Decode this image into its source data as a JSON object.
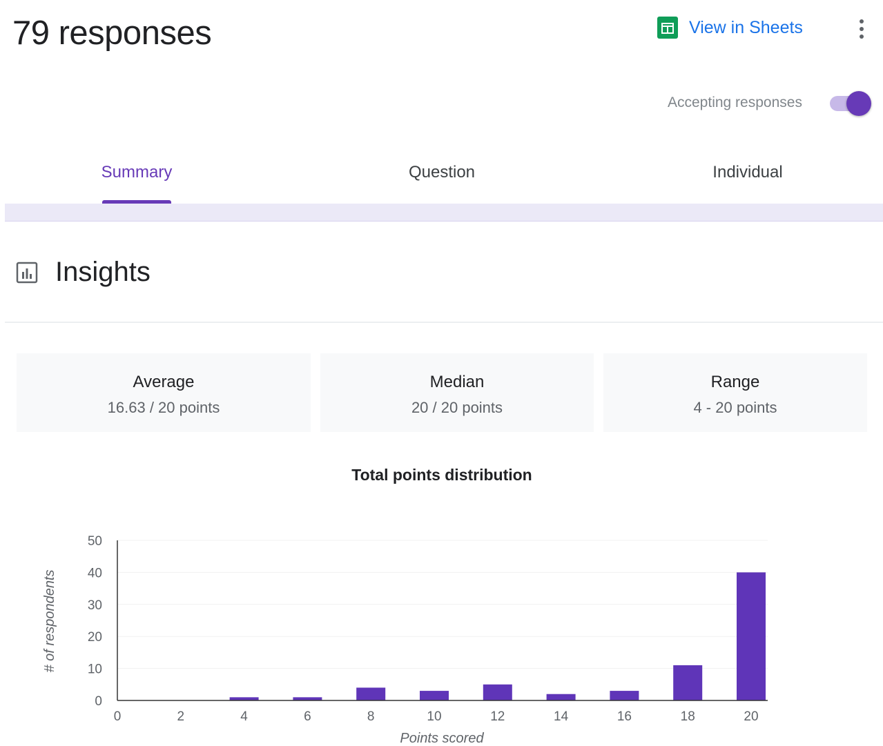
{
  "header": {
    "title": "79 responses",
    "view_in_sheets": "View in Sheets",
    "accepting_label": "Accepting responses",
    "accepting_on": true
  },
  "tabs": [
    {
      "label": "Summary",
      "active": true
    },
    {
      "label": "Question",
      "active": false
    },
    {
      "label": "Individual",
      "active": false
    }
  ],
  "insights": {
    "title": "Insights",
    "stats": [
      {
        "label": "Average",
        "value": "16.63 / 20 points"
      },
      {
        "label": "Median",
        "value": "20 / 20 points"
      },
      {
        "label": "Range",
        "value": "4 - 20 points"
      }
    ]
  },
  "colors": {
    "accent": "#673ab7",
    "accent_light": "#c7b9e8",
    "link": "#1a73e8",
    "sheets_green": "#0f9d58",
    "bar": "#5f35b8"
  },
  "icons": {
    "sheets": "sheets-icon",
    "more": "more-vert-icon",
    "insights": "insights-chart-icon"
  },
  "chart_data": {
    "type": "bar",
    "title": "Total points distribution",
    "xlabel": "Points scored",
    "ylabel": "# of respondents",
    "xlim": [
      0,
      20
    ],
    "ylim": [
      0,
      50
    ],
    "xticks": [
      0,
      2,
      4,
      6,
      8,
      10,
      12,
      14,
      16,
      18,
      20
    ],
    "yticks": [
      0,
      10,
      20,
      30,
      40,
      50
    ],
    "x": [
      4,
      6,
      8,
      10,
      12,
      14,
      16,
      18,
      20
    ],
    "values": [
      1,
      1,
      4,
      3,
      5,
      2,
      3,
      11,
      40
    ],
    "grid": true,
    "legend": "none"
  }
}
